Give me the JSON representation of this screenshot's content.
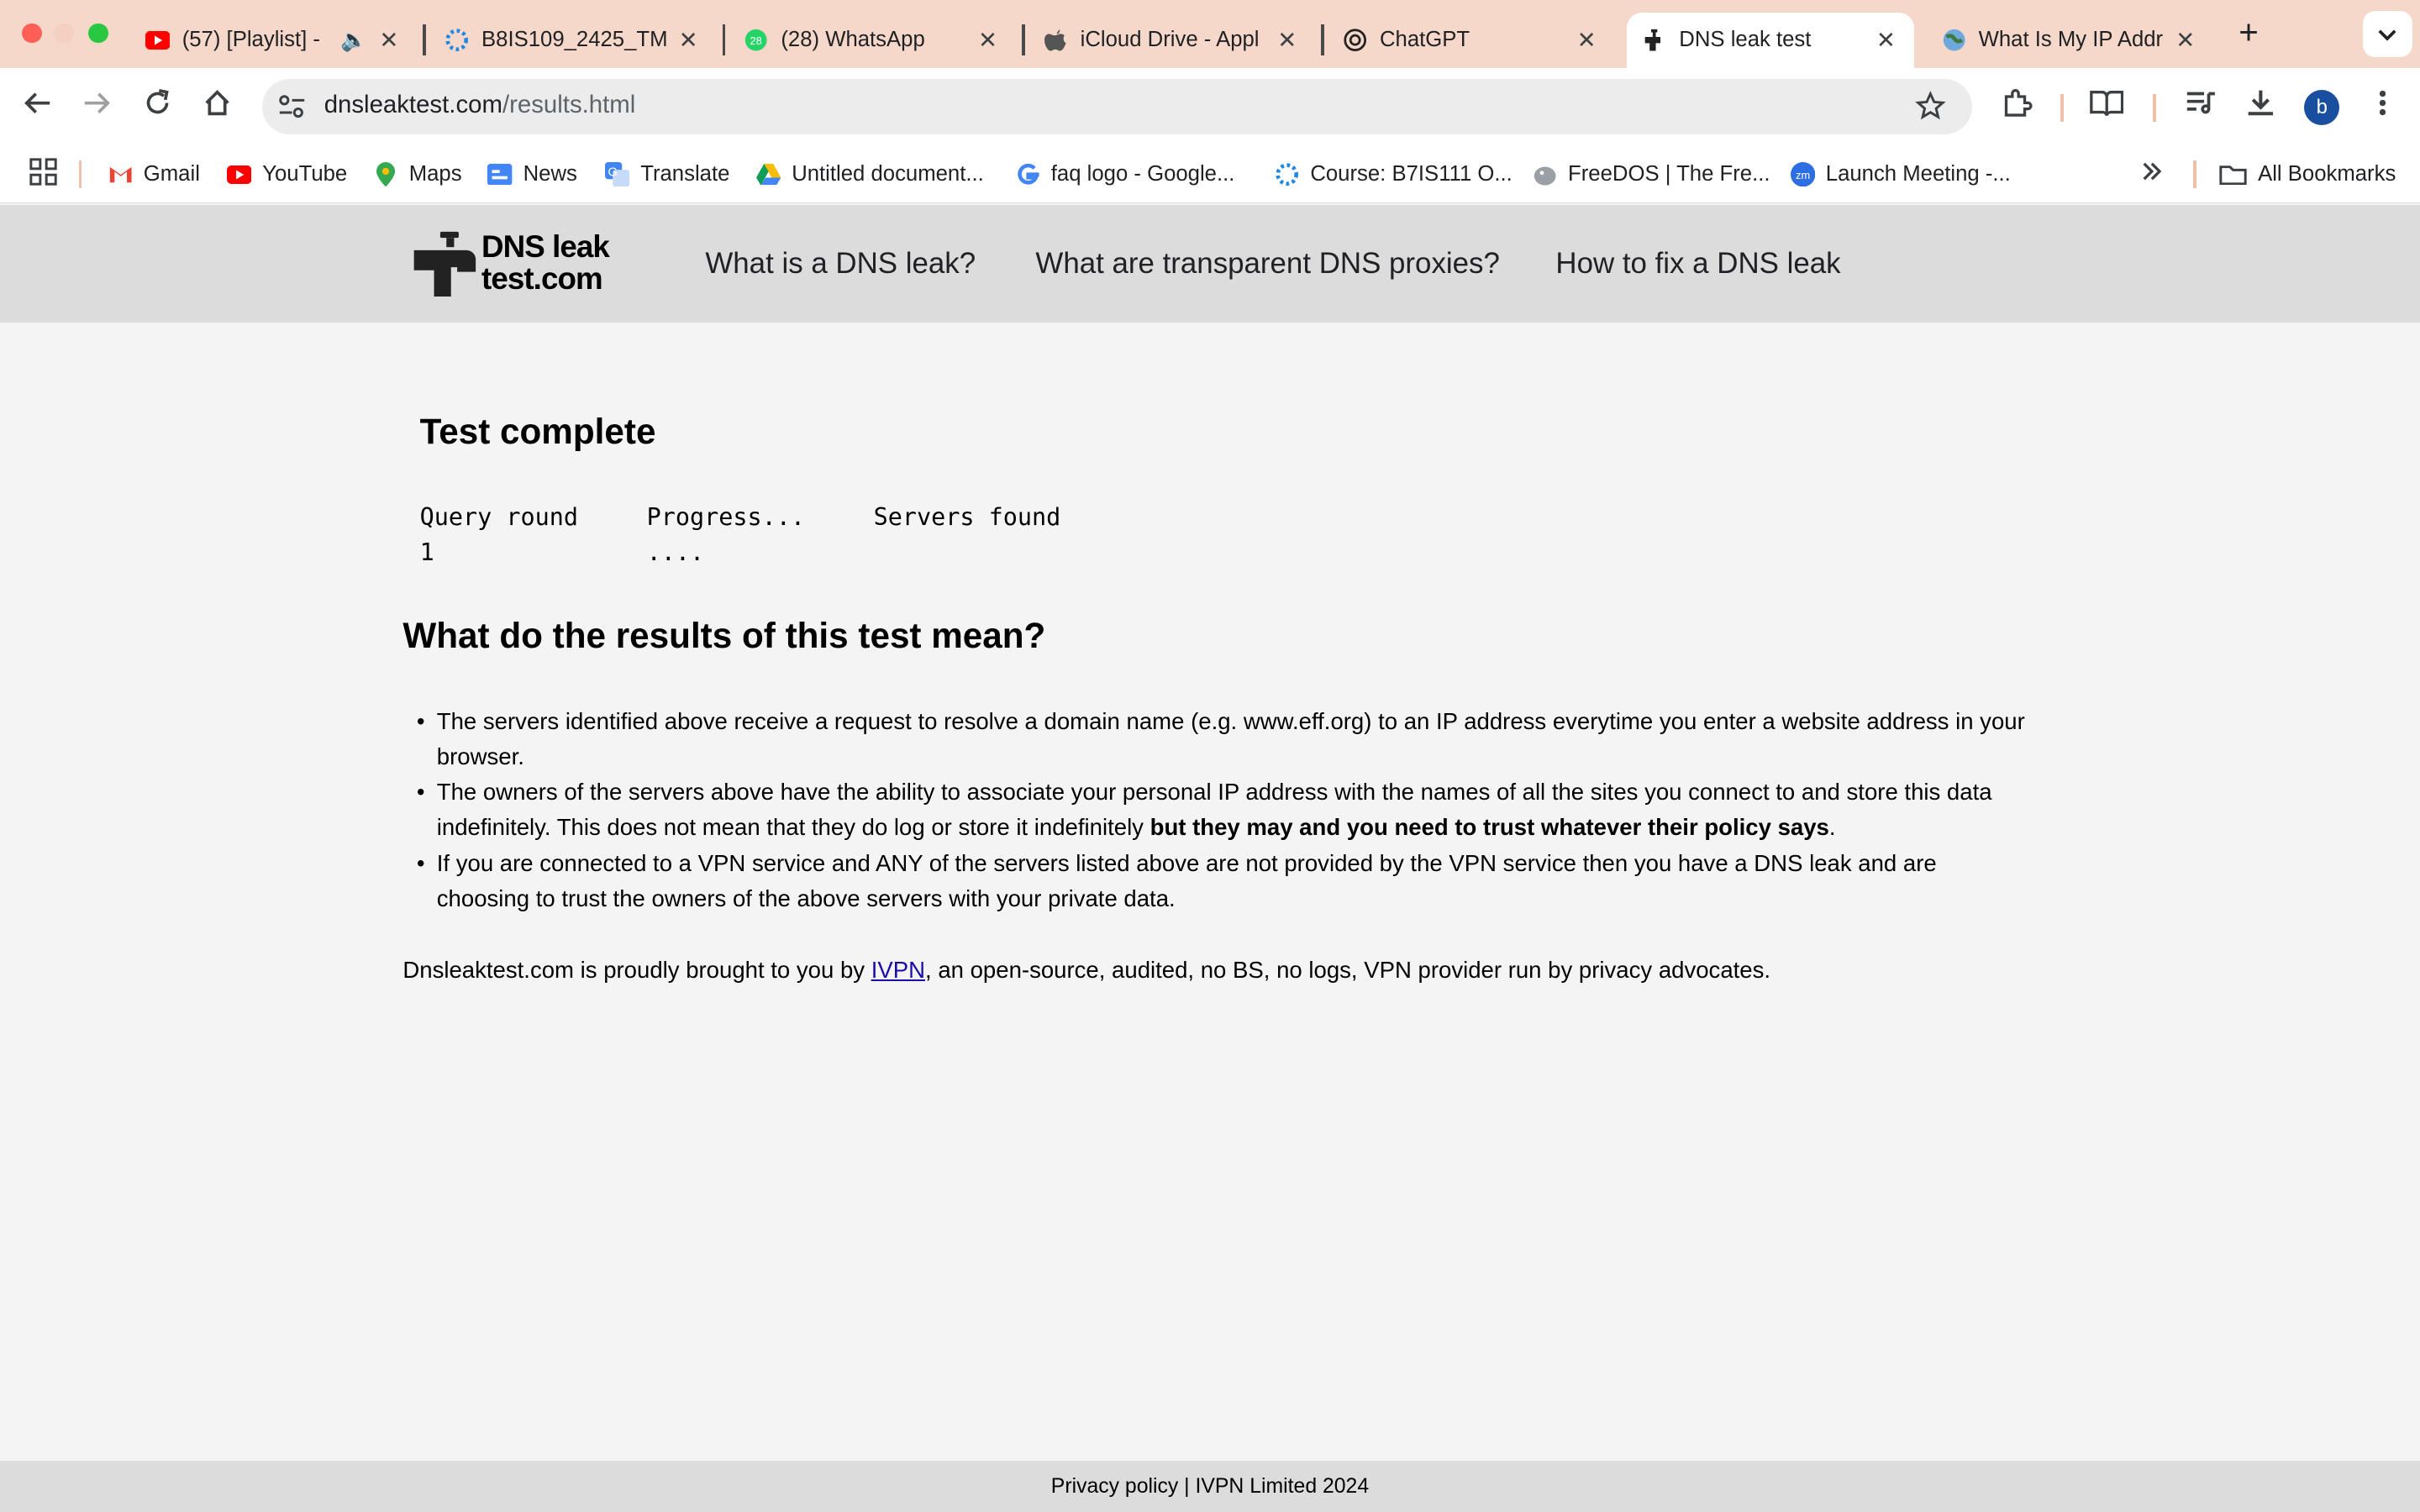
{
  "browser": {
    "tabs": [
      {
        "title": "(57) [Playlist] -",
        "icon": "youtube-icon",
        "audio": true
      },
      {
        "title": "B8IS109_2425_TM",
        "icon": "moodle-spinner-icon"
      },
      {
        "title": "(28) WhatsApp",
        "icon": "whatsapp-icon"
      },
      {
        "title": "iCloud Drive - Appl",
        "icon": "apple-icon"
      },
      {
        "title": "ChatGPT",
        "icon": "chatgpt-icon"
      },
      {
        "title": "DNS leak test",
        "icon": "faucet-icon",
        "active": true
      },
      {
        "title": "What Is My IP Addr",
        "icon": "globe-icon"
      }
    ],
    "address": {
      "host": "dnsleaktest.com",
      "path": "/results.html"
    },
    "profile_initial": "b",
    "bookmarks": [
      {
        "label": "Gmail",
        "icon": "gmail-icon"
      },
      {
        "label": "YouTube",
        "icon": "youtube-icon"
      },
      {
        "label": "Maps",
        "icon": "maps-icon"
      },
      {
        "label": "News",
        "icon": "news-icon"
      },
      {
        "label": "Translate",
        "icon": "translate-icon"
      },
      {
        "label": "Untitled document...",
        "icon": "drive-icon"
      },
      {
        "label": "faq logo - Google...",
        "icon": "google-icon"
      },
      {
        "label": "Course: B7IS111 O...",
        "icon": "moodle-spinner-icon"
      },
      {
        "label": "FreeDOS | The Fre...",
        "icon": "freedos-icon"
      },
      {
        "label": "Launch Meeting -...",
        "icon": "zoom-icon"
      }
    ],
    "all_bookmarks_label": "All Bookmarks"
  },
  "site": {
    "logo_line1": "DNS leak",
    "logo_line2": "test.com",
    "nav": [
      "What is a DNS leak?",
      "What are transparent DNS proxies?",
      "How to fix a DNS leak"
    ]
  },
  "results": {
    "heading": "Test complete",
    "columns": [
      "Query round",
      "Progress...",
      "Servers found"
    ],
    "row": {
      "round": "1",
      "progress": "....",
      "servers": ""
    }
  },
  "explanation": {
    "heading": "What do the results of this test mean?",
    "bullet1": "The servers identified above receive a request to resolve a domain name (e.g. www.eff.org) to an IP address everytime you enter a website address in your browser.",
    "bullet2": "The owners of the servers above have the ability to associate your personal IP address with the names of all the sites you connect to and store this data indefinitely. This does not mean that they do log or store it indefinitely ",
    "bullet2_bold": "but they may and you need to trust whatever their policy says",
    "bullet2_end": ".",
    "bullet3": "If you are connected to a VPN service and ANY of the servers listed above are not provided by the VPN service then you have a DNS leak and are choosing to trust the owners of the above servers with your private data."
  },
  "credit": {
    "prefix": "Dnsleaktest.com is proudly brought to you by ",
    "link": "IVPN",
    "suffix": ", an open-source, audited, no BS, no logs, VPN provider run by privacy advocates."
  },
  "footer": {
    "text": "Privacy policy | IVPN Limited 2024"
  }
}
